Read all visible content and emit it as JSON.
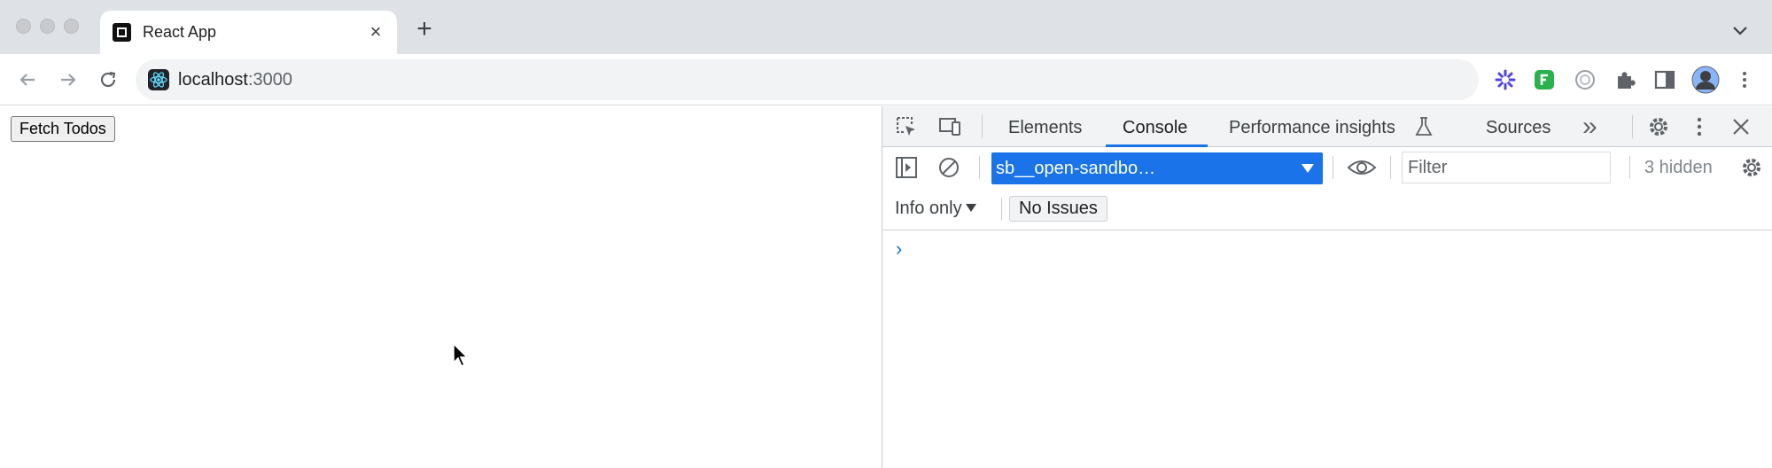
{
  "browser": {
    "tab": {
      "title": "React App",
      "close_glyph": "×"
    },
    "new_tab_glyph": "+",
    "address": {
      "host": "localhost",
      "port": ":3000"
    },
    "extensions": [
      "asterisk-extension-icon",
      "feedly-extension-icon",
      "circle-extension-icon",
      "puzzle-icon",
      "side-panel-icon",
      "profile-avatar"
    ]
  },
  "page": {
    "fetch_button_label": "Fetch Todos"
  },
  "devtools": {
    "tabs": [
      {
        "label": "Elements"
      },
      {
        "label": "Console",
        "active": true
      },
      {
        "label": "Performance insights"
      },
      {
        "label": "Sources"
      }
    ],
    "more_tabs_glyph": "»",
    "context_selector": "sb__open-sandbo…",
    "filter_placeholder": "Filter",
    "hidden_count": "3 hidden",
    "levels_label": "Info only",
    "issues_label": "No Issues",
    "prompt_glyph": "›",
    "colors": {
      "accent": "#1a73e8",
      "panel_bg": "#f1f3f4"
    }
  }
}
